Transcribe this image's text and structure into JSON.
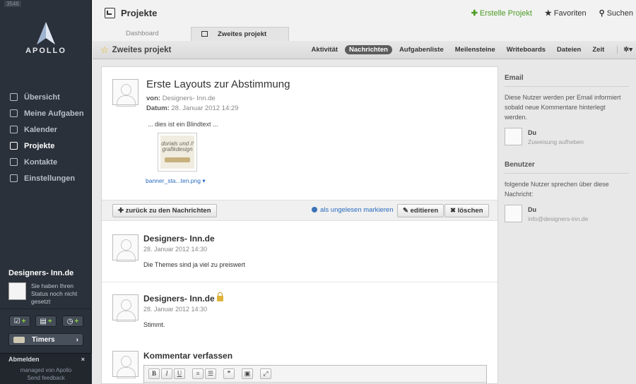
{
  "sidebar": {
    "build": "3546",
    "logo_text": "APOLLO",
    "items": [
      {
        "label": "Übersicht",
        "icon": "overview-icon"
      },
      {
        "label": "Meine Aufgaben",
        "icon": "check-icon"
      },
      {
        "label": "Kalender",
        "icon": "calendar-icon"
      },
      {
        "label": "Projekte",
        "icon": "project-icon",
        "active": true
      },
      {
        "label": "Kontakte",
        "icon": "contacts-icon"
      },
      {
        "label": "Einstellungen",
        "icon": "settings-icon"
      }
    ],
    "user": {
      "name": "Designers- Inn.de",
      "status": "Sie haben Ihren Status noch nicht gesetzt"
    },
    "quick_plus": "+",
    "timers_label": "Timers",
    "logout_label": "Abmelden",
    "close_symbol": "×",
    "managed_by": "managed von Apollo",
    "feedback": "Send feedback"
  },
  "topbar": {
    "title": "Projekte",
    "create": "Erstelle Projekt",
    "favorites": "Favoriten",
    "search": "Suchen"
  },
  "tabs": {
    "dashboard": "Dashboard",
    "active": "Zweites projekt"
  },
  "subbar": {
    "title": "Zweites projekt",
    "nav": [
      "Aktivität",
      "Nachrichten",
      "Aufgabenliste",
      "Meilensteine",
      "Writeboards",
      "Dateien",
      "Zeit"
    ],
    "active_nav": "Nachrichten"
  },
  "message": {
    "title": "Erste Layouts zur Abstimmung",
    "from_label": "von:",
    "from": "Designers- Inn.de",
    "date_label": "Datum:",
    "date": "28. Januar 2012 14:29",
    "body": "... dies ist ein Blindtext ...",
    "attachment_thumb_text": "dorials und // grafikdesign",
    "attachment": "banner_sta...ten.png"
  },
  "actions": {
    "back": "zurück zu den Nachrichten",
    "unread": "als ungelesen markieren",
    "edit": "editieren",
    "delete": "löschen"
  },
  "comments": [
    {
      "author": "Designers- Inn.de",
      "date": "28. Januar 2012 14:30",
      "text": "Die Themes sind ja viel zu preiswert"
    },
    {
      "author": "Designers- Inn.de",
      "date": "28. Januar 2012 14:30",
      "text": "Stimmt.",
      "private": true
    }
  ],
  "compose": {
    "title": "Kommentar verfassen",
    "toolbar": [
      "B",
      "I",
      "U"
    ]
  },
  "right": {
    "email_heading": "Email",
    "email_text": "Diese Nutzer werden per Email informiert sobald neue Kommentare hinterlegt werden.",
    "email_user": {
      "name": "Du",
      "action": "Zuweisung aufheben"
    },
    "users_heading": "Benutzer",
    "users_text": "folgende Nutzer sprechen über diese Nachricht:",
    "user": {
      "name": "Du",
      "email": "info@designers-inn.de"
    }
  },
  "colors": {
    "accent_green": "#4d9c25",
    "link_blue": "#2a6bbf",
    "sidebar": "#2b313a"
  }
}
